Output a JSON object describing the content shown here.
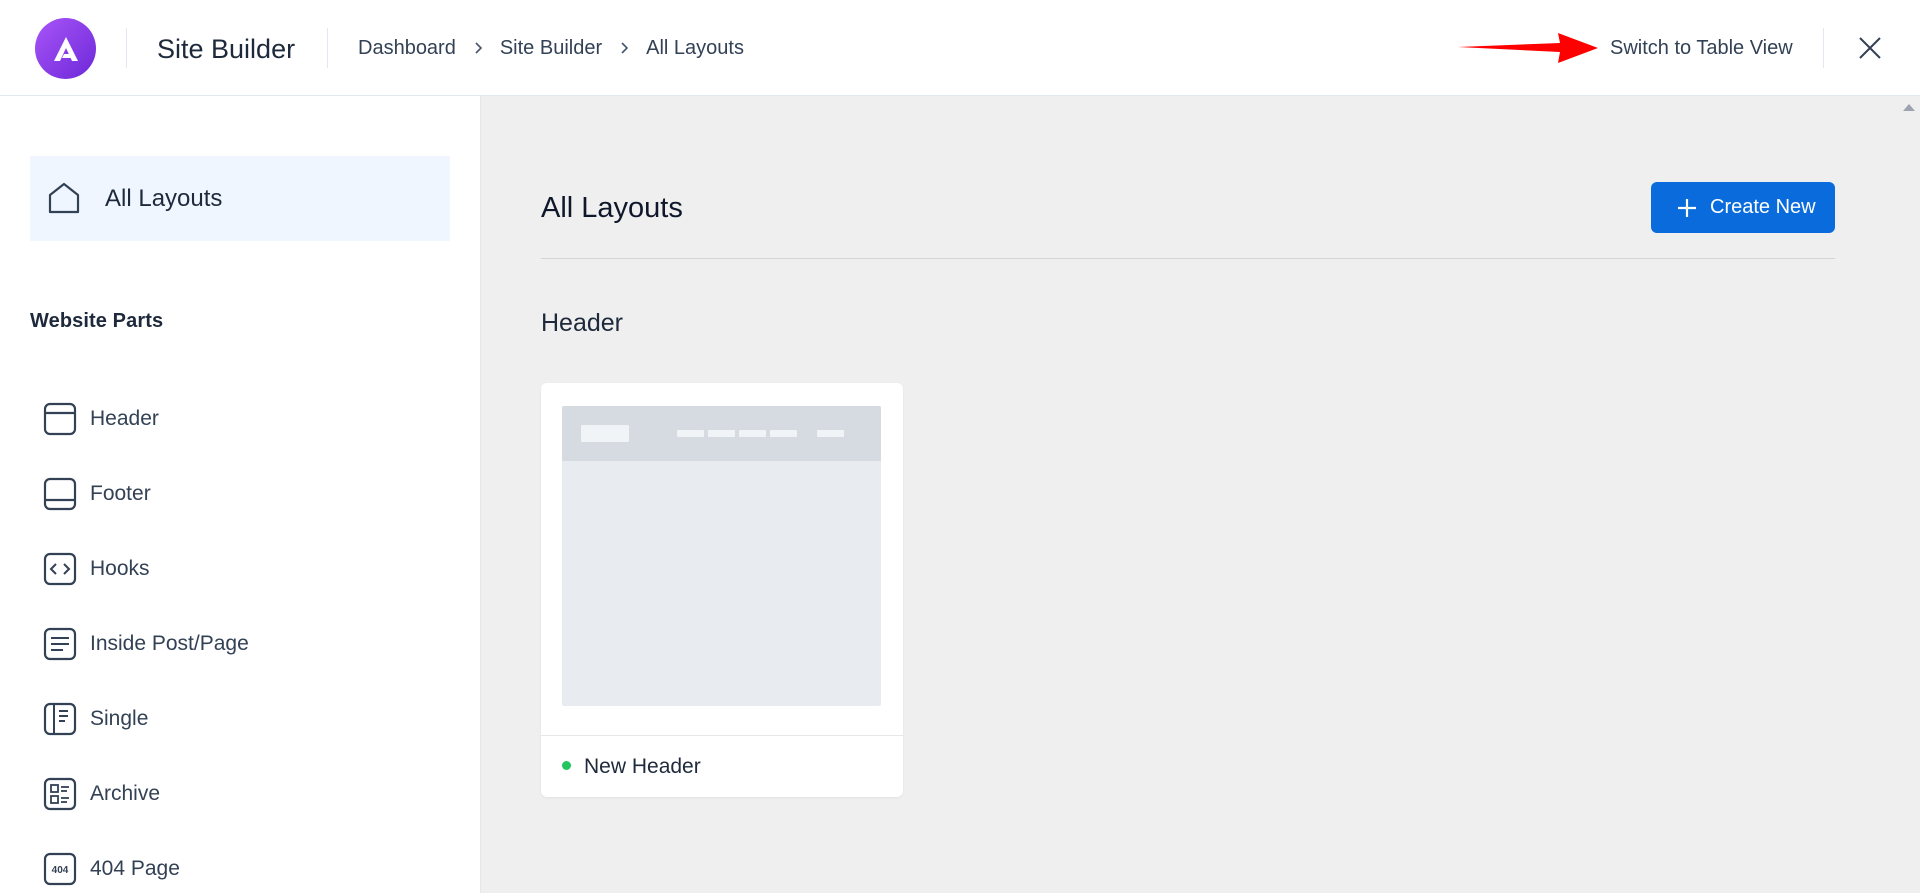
{
  "header": {
    "app_title": "Site Builder",
    "breadcrumbs": [
      "Dashboard",
      "Site Builder",
      "All Layouts"
    ],
    "switch_view_label": "Switch to Table View",
    "accent_color": "#6d28d9",
    "annotation_arrow_color": "#ff0000"
  },
  "sidebar": {
    "all_layouts_label": "All Layouts",
    "section_title": "Website Parts",
    "items": [
      {
        "label": "Header",
        "icon": "header-layout-icon"
      },
      {
        "label": "Footer",
        "icon": "footer-layout-icon"
      },
      {
        "label": "Hooks",
        "icon": "code-icon"
      },
      {
        "label": "Inside Post/Page",
        "icon": "content-lines-icon"
      },
      {
        "label": "Single",
        "icon": "single-post-icon"
      },
      {
        "label": "Archive",
        "icon": "archive-grid-icon"
      },
      {
        "label": "404 Page",
        "icon": "404-icon"
      }
    ]
  },
  "main": {
    "title": "All Layouts",
    "create_button_label": "Create New",
    "create_button_color": "#0a6cdc",
    "groups": [
      {
        "title": "Header",
        "cards": [
          {
            "name": "New Header",
            "status": "published",
            "status_color": "#22c55e"
          }
        ]
      }
    ]
  }
}
